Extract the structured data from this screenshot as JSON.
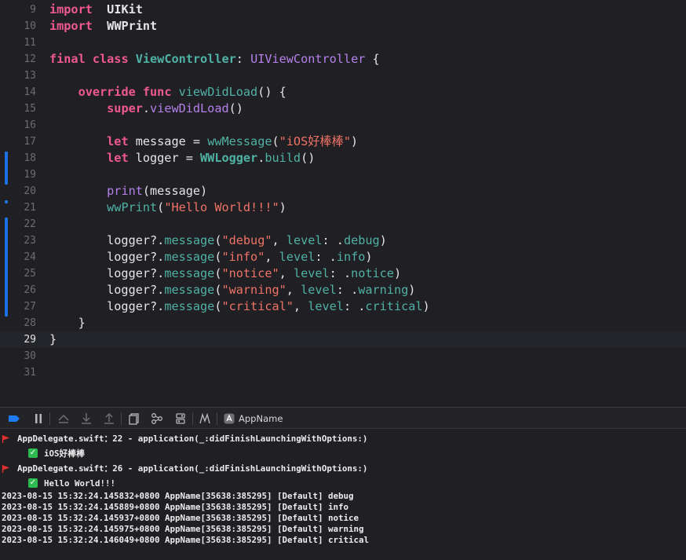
{
  "editor": {
    "current_line": "29",
    "lines": [
      {
        "n": "9",
        "segs": [
          [
            "kw",
            "import"
          ],
          [
            "",
            "  "
          ],
          [
            "mod",
            "UIKit"
          ]
        ]
      },
      {
        "n": "10",
        "segs": [
          [
            "kw",
            "import"
          ],
          [
            "",
            "  "
          ],
          [
            "mod",
            "WWPrint"
          ]
        ]
      },
      {
        "n": "11",
        "segs": []
      },
      {
        "n": "12",
        "segs": [
          [
            "kw",
            "final"
          ],
          [
            "",
            " "
          ],
          [
            "kw",
            "class"
          ],
          [
            "",
            " "
          ],
          [
            "ty",
            "ViewController"
          ],
          [
            "",
            ": "
          ],
          [
            "sys",
            "UIViewController"
          ],
          [
            "",
            " {"
          ]
        ]
      },
      {
        "n": "13",
        "segs": []
      },
      {
        "n": "14",
        "segs": [
          [
            "",
            "    "
          ],
          [
            "kw",
            "override"
          ],
          [
            "",
            " "
          ],
          [
            "kw",
            "func"
          ],
          [
            "",
            " "
          ],
          [
            "fn",
            "viewDidLoad"
          ],
          [
            "",
            "() {"
          ]
        ]
      },
      {
        "n": "15",
        "segs": [
          [
            "",
            "        "
          ],
          [
            "kw",
            "super"
          ],
          [
            "",
            "."
          ],
          [
            "sys",
            "viewDidLoad"
          ],
          [
            "",
            "()"
          ]
        ]
      },
      {
        "n": "16",
        "segs": []
      },
      {
        "n": "17",
        "segs": [
          [
            "",
            "        "
          ],
          [
            "kw",
            "let"
          ],
          [
            "",
            " message = "
          ],
          [
            "fn",
            "wwMessage"
          ],
          [
            "",
            "("
          ],
          [
            "str",
            "\"iOS好棒棒\""
          ],
          [
            "",
            ")"
          ]
        ]
      },
      {
        "n": "18",
        "segs": [
          [
            "",
            "        "
          ],
          [
            "kw",
            "let"
          ],
          [
            "",
            " logger = "
          ],
          [
            "ty",
            "WWLogger"
          ],
          [
            "",
            "."
          ],
          [
            "fn",
            "build"
          ],
          [
            "",
            "()"
          ]
        ]
      },
      {
        "n": "19",
        "segs": []
      },
      {
        "n": "20",
        "segs": [
          [
            "",
            "        "
          ],
          [
            "sys",
            "print"
          ],
          [
            "",
            "(message)"
          ]
        ]
      },
      {
        "n": "21",
        "segs": [
          [
            "",
            "        "
          ],
          [
            "fn",
            "wwPrint"
          ],
          [
            "",
            "("
          ],
          [
            "str",
            "\"Hello World!!!\""
          ],
          [
            "",
            ")"
          ]
        ]
      },
      {
        "n": "22",
        "segs": []
      },
      {
        "n": "23",
        "segs": [
          [
            "",
            "        logger?."
          ],
          [
            "fn",
            "message"
          ],
          [
            "",
            "("
          ],
          [
            "str",
            "\"debug\""
          ],
          [
            "",
            ", "
          ],
          [
            "fn",
            "level"
          ],
          [
            "",
            ": ."
          ],
          [
            "fn",
            "debug"
          ],
          [
            "",
            ")"
          ]
        ]
      },
      {
        "n": "24",
        "segs": [
          [
            "",
            "        logger?."
          ],
          [
            "fn",
            "message"
          ],
          [
            "",
            "("
          ],
          [
            "str",
            "\"info\""
          ],
          [
            "",
            ", "
          ],
          [
            "fn",
            "level"
          ],
          [
            "",
            ": ."
          ],
          [
            "fn",
            "info"
          ],
          [
            "",
            ")"
          ]
        ]
      },
      {
        "n": "25",
        "segs": [
          [
            "",
            "        logger?."
          ],
          [
            "fn",
            "message"
          ],
          [
            "",
            "("
          ],
          [
            "str",
            "\"notice\""
          ],
          [
            "",
            ", "
          ],
          [
            "fn",
            "level"
          ],
          [
            "",
            ": ."
          ],
          [
            "fn",
            "notice"
          ],
          [
            "",
            ")"
          ]
        ]
      },
      {
        "n": "26",
        "segs": [
          [
            "",
            "        logger?."
          ],
          [
            "fn",
            "message"
          ],
          [
            "",
            "("
          ],
          [
            "str",
            "\"warning\""
          ],
          [
            "",
            ", "
          ],
          [
            "fn",
            "level"
          ],
          [
            "",
            ": ."
          ],
          [
            "fn",
            "warning"
          ],
          [
            "",
            ")"
          ]
        ]
      },
      {
        "n": "27",
        "segs": [
          [
            "",
            "        logger?."
          ],
          [
            "fn",
            "message"
          ],
          [
            "",
            "("
          ],
          [
            "str",
            "\"critical\""
          ],
          [
            "",
            ", "
          ],
          [
            "fn",
            "level"
          ],
          [
            "",
            ": ."
          ],
          [
            "fn",
            "critical"
          ],
          [
            "",
            ")"
          ]
        ]
      },
      {
        "n": "28",
        "segs": [
          [
            "",
            "    }"
          ]
        ]
      },
      {
        "n": "29",
        "segs": [
          [
            "",
            "}"
          ]
        ]
      },
      {
        "n": "30",
        "segs": []
      },
      {
        "n": "31",
        "segs": []
      }
    ]
  },
  "debug_bar": {
    "icons": [
      "breakpoints-toggle-icon",
      "pause-icon",
      "step-over-icon",
      "step-into-icon",
      "step-out-icon",
      "view-hierarchy-icon",
      "memory-graph-icon",
      "environment-overrides-icon",
      "simulate-location-icon"
    ],
    "process_icon": "app-icon",
    "process_name": "AppName"
  },
  "console": {
    "entries": [
      {
        "type": "source",
        "text": "AppDelegate.swift：22 - application(_:didFinishLaunchingWithOptions:)"
      },
      {
        "type": "message",
        "text": "iOS好棒棒"
      },
      {
        "type": "source",
        "text": "AppDelegate.swift：26 - application(_:didFinishLaunchingWithOptions:)"
      },
      {
        "type": "message",
        "text": "Hello World!!!"
      },
      {
        "type": "log",
        "text": "2023-08-15 15:32:24.145832+0800 AppName[35638:385295] [Default] debug"
      },
      {
        "type": "log",
        "text": "2023-08-15 15:32:24.145889+0800 AppName[35638:385295] [Default] info"
      },
      {
        "type": "log",
        "text": "2023-08-15 15:32:24.145937+0800 AppName[35638:385295] [Default] notice"
      },
      {
        "type": "log",
        "text": "2023-08-15 15:32:24.145975+0800 AppName[35638:385295] [Default] warning"
      },
      {
        "type": "log",
        "text": "2023-08-15 15:32:24.146049+0800 AppName[35638:385295] [Default] critical"
      }
    ]
  },
  "colors": {
    "background": "#1f1f24",
    "keyword": "#f0598f",
    "type": "#50b2a4",
    "system": "#b581ea",
    "string": "#f07366",
    "change_bar": "#1d6fe6",
    "flag": "#e0312e",
    "check": "#2dba4e"
  }
}
